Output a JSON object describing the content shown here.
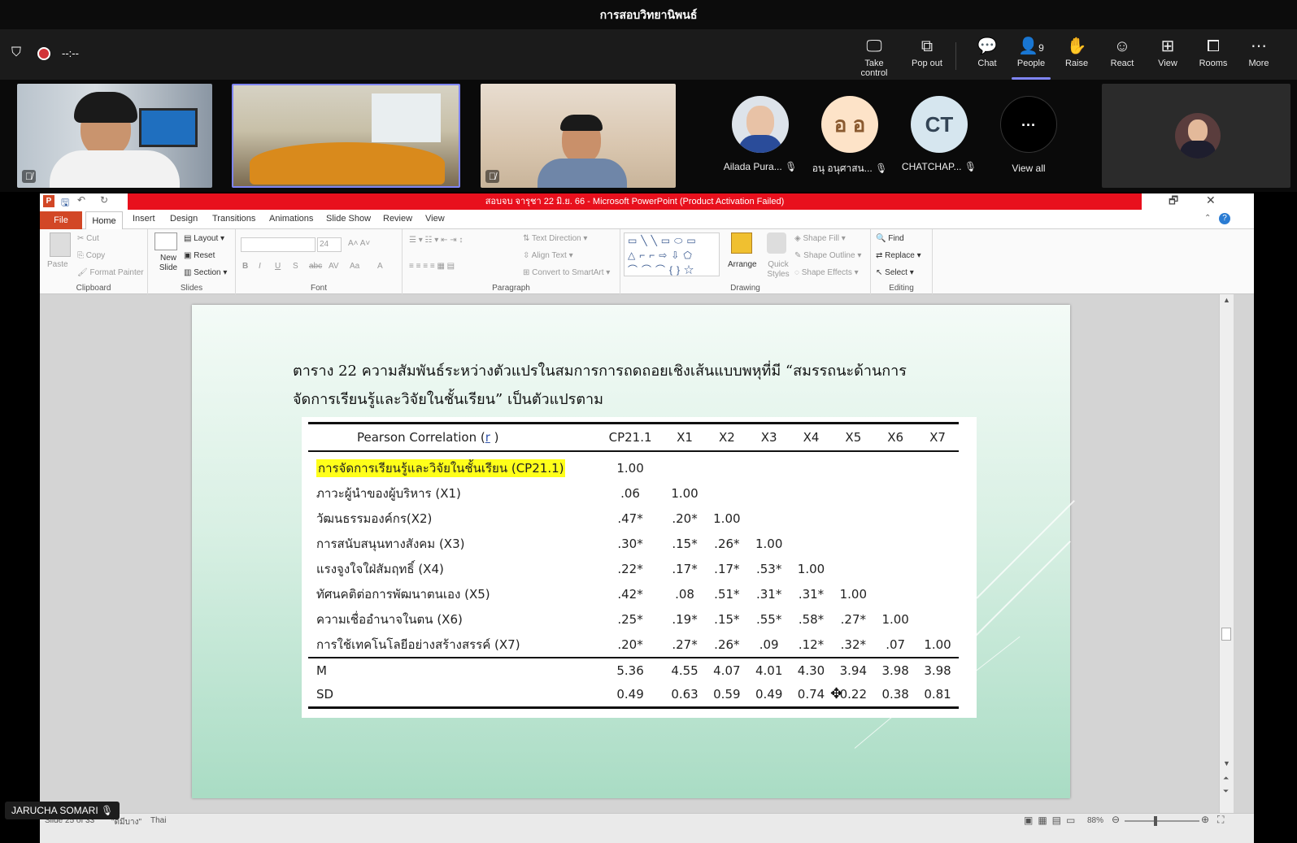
{
  "teams": {
    "meeting_title": "การสอบวิทยานิพนธ์",
    "timer": "--:--",
    "buttons": [
      {
        "name": "take-control",
        "label": "Take control",
        "icon": "monitor-icon"
      },
      {
        "name": "pop-out",
        "label": "Pop out",
        "icon": "popout-icon"
      },
      {
        "name": "chat",
        "label": "Chat",
        "icon": "chat-icon"
      },
      {
        "name": "people",
        "label": "People",
        "icon": "people-icon",
        "count": "9"
      },
      {
        "name": "raise",
        "label": "Raise",
        "icon": "hand-icon"
      },
      {
        "name": "react",
        "label": "React",
        "icon": "smile-icon"
      },
      {
        "name": "view",
        "label": "View",
        "icon": "grid-icon"
      },
      {
        "name": "rooms",
        "label": "Rooms",
        "icon": "rooms-icon"
      },
      {
        "name": "more",
        "label": "More",
        "icon": "more-icon"
      }
    ],
    "participants": [
      {
        "initials": "",
        "name": "Ailada Pura...",
        "avatar_color": "#2a4c9a"
      },
      {
        "initials": "อ อ",
        "name": "อนุ อนุศาสน...",
        "avatar_color": "#fde3c8"
      },
      {
        "initials": "CT",
        "name": "CHATCHAP...",
        "avatar_color": "#d6e6ef"
      }
    ],
    "view_all": "View all",
    "view_all_glyph": "···",
    "user_tag": "JARUCHA SOMARI"
  },
  "ppt": {
    "window_title": "สอบจบ จารุชา 22 มิ.ย. 66 - Microsoft PowerPoint (Product Activation Failed)",
    "tabs": [
      "File",
      "Home",
      "Insert",
      "Design",
      "Transitions",
      "Animations",
      "Slide Show",
      "Review",
      "View"
    ],
    "ribbon": {
      "clipboard": {
        "paste": "Paste",
        "cut": "Cut",
        "copy": "Copy",
        "format_painter": "Format Painter",
        "label": "Clipboard"
      },
      "slides": {
        "new_slide": "New Slide",
        "layout": "Layout",
        "reset": "Reset",
        "section": "Section",
        "label": "Slides"
      },
      "font": {
        "size": "24",
        "label": "Font"
      },
      "paragraph": {
        "text_direction": "Text Direction",
        "align_text": "Align Text",
        "smartart": "Convert to SmartArt",
        "label": "Paragraph"
      },
      "drawing": {
        "arrange": "Arrange",
        "quick_styles": "Quick Styles",
        "shape_fill": "Shape Fill",
        "shape_outline": "Shape Outline",
        "shape_effects": "Shape Effects",
        "label": "Drawing"
      },
      "editing": {
        "find": "Find",
        "replace": "Replace",
        "select": "Select",
        "label": "Editing"
      }
    },
    "status": {
      "slide": "Slide 25 of 33",
      "theme": "\"ดีมีบาง\"",
      "language": "Thai",
      "zoom": "88%"
    }
  },
  "slide": {
    "title_line1": "ตาราง 22 ความสัมพันธ์ระหว่างตัวแปรในสมการการถดถอยเชิงเส้นแบบพหุที่มี “สมรรถนะด้านการ",
    "title_line2": "จัดการเรียนรู้และวิจัยในชั้นเรียน” เป็นตัวแปรตาม",
    "table": {
      "header_prefix": "Pearson Correlation (",
      "header_r": "r",
      "header_suffix": " )",
      "columns": [
        "CP21.1",
        "X1",
        "X2",
        "X3",
        "X4",
        "X5",
        "X6",
        "X7"
      ],
      "rows": [
        {
          "label": "การจัดการเรียนรู้และวิจัยในชั้นเรียน (CP21.1)",
          "values": [
            "1.00",
            "",
            "",
            "",
            "",
            "",
            "",
            ""
          ]
        },
        {
          "label": "ภาวะผู้นำของผู้บริหาร (X1)",
          "values": [
            ".06",
            "1.00",
            "",
            "",
            "",
            "",
            "",
            ""
          ]
        },
        {
          "label": "วัฒนธรรมองค์กร(X2)",
          "values": [
            ".47*",
            ".20*",
            "1.00",
            "",
            "",
            "",
            "",
            ""
          ]
        },
        {
          "label": "การสนับสนุนทางสังคม (X3)",
          "values": [
            ".30*",
            ".15*",
            ".26*",
            "1.00",
            "",
            "",
            "",
            ""
          ]
        },
        {
          "label": "แรงจูงใจใฝ่สัมฤทธิ์ (X4)",
          "values": [
            ".22*",
            ".17*",
            ".17*",
            ".53*",
            "1.00",
            "",
            "",
            ""
          ]
        },
        {
          "label": "ทัศนคติต่อการพัฒนาตนเอง (X5)",
          "values": [
            ".42*",
            ".08",
            ".51*",
            ".31*",
            ".31*",
            "1.00",
            "",
            ""
          ]
        },
        {
          "label": "ความเชื่ออำนาจในตน  (X6)",
          "values": [
            ".25*",
            ".19*",
            ".15*",
            ".55*",
            ".58*",
            ".27*",
            "1.00",
            ""
          ]
        },
        {
          "label": "การใช้เทคโนโลยีอย่างสร้างสรรค์ (X7)",
          "values": [
            ".20*",
            ".27*",
            ".26*",
            ".09",
            ".12*",
            ".32*",
            ".07",
            "1.00"
          ]
        }
      ],
      "m_row": {
        "label": "M",
        "values": [
          "5.36",
          "4.55",
          "4.07",
          "4.01",
          "4.30",
          "3.94",
          "3.98",
          "3.98"
        ]
      },
      "sd_row": {
        "label": "SD",
        "values": [
          "0.49",
          "0.63",
          "0.59",
          "0.49",
          "0.74",
          "0.22",
          "0.38",
          "0.81"
        ]
      }
    }
  }
}
